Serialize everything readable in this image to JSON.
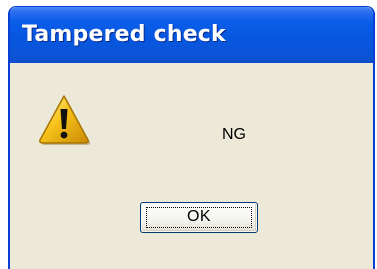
{
  "window": {
    "title": "Tampered check"
  },
  "dialog": {
    "icon": "warning-icon",
    "message": "NG"
  },
  "buttons": {
    "ok_label": "OK"
  },
  "colors": {
    "titlebar": "#0756e0",
    "client_background": "#ece9d8",
    "warning_yellow": "#f7c21b"
  }
}
